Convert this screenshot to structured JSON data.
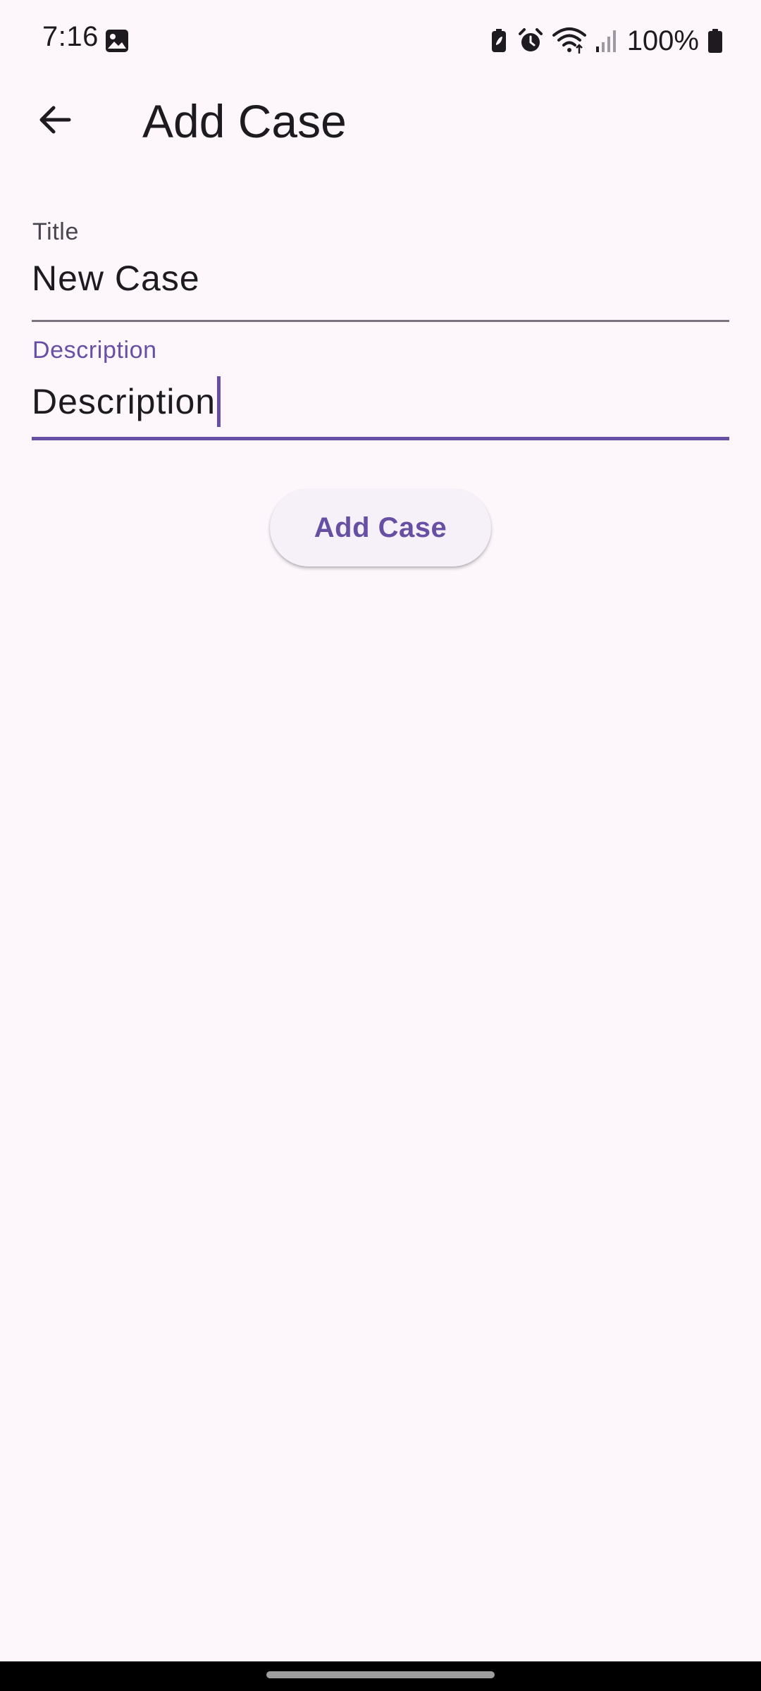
{
  "status_bar": {
    "time": "7:16",
    "battery_percent": "100%",
    "icons": [
      "gallery-notification-icon",
      "battery-saver-icon",
      "alarm-icon",
      "wifi-icon",
      "signal-icon",
      "battery-icon"
    ]
  },
  "app_bar": {
    "title": "Add Case",
    "back_icon": "arrow-back-icon"
  },
  "form": {
    "title_field": {
      "label": "Title",
      "value": "New Case"
    },
    "description_field": {
      "label": "Description",
      "value": "Description",
      "focused": true
    },
    "submit_label": "Add Case"
  },
  "colors": {
    "background": "#FDF7FC",
    "primary": "#6750A4",
    "on_surface": "#1D1B20",
    "label": "#49454F",
    "underline": "#79747E",
    "button_surface": "#F6F1F8"
  }
}
